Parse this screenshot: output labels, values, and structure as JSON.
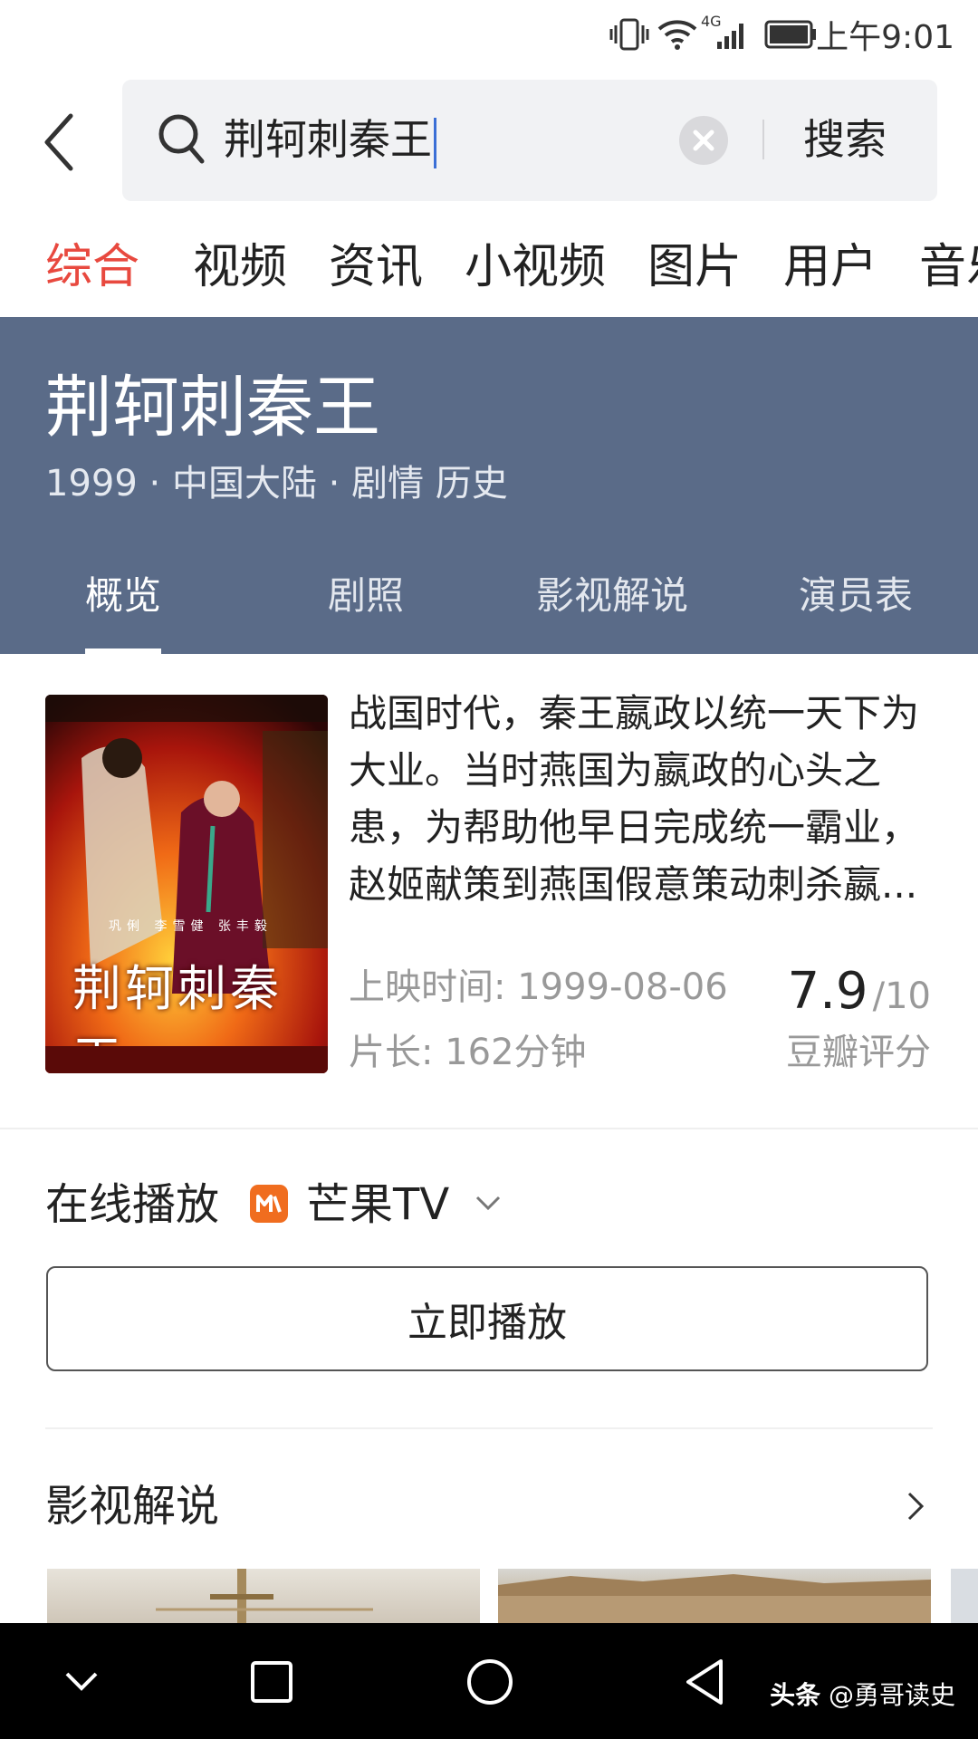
{
  "status_bar": {
    "time": "上午9:01",
    "network": "4G"
  },
  "search": {
    "query": "荆轲刺秦王",
    "submit_label": "搜索"
  },
  "category_tabs": [
    "综合",
    "视频",
    "资讯",
    "小视频",
    "图片",
    "用户",
    "音乐"
  ],
  "movie": {
    "title": "荆轲刺秦王",
    "meta": "1999 · 中国大陆 · 剧情 历史",
    "detail_tabs": [
      "概览",
      "剧照",
      "影视解说",
      "演员表"
    ],
    "synopsis_lines": [
      "战国时代，秦王嬴政以统一天下为",
      "大业。当时燕国为嬴政的心头之",
      "患，为帮助他早日完成统一霸业，",
      "赵姬献策到燕国假意策动刺杀嬴..."
    ],
    "release": "上映时间: 1999-08-06",
    "duration": "片长: 162分钟",
    "score": "7.9",
    "score_max": "/10",
    "score_label": "豆瓣评分",
    "poster_title": "荆轲刺秦王",
    "poster_cast": [
      "巩俐",
      "李雪健",
      "张丰毅"
    ]
  },
  "online": {
    "label": "在线播放",
    "platform": "芒果TV",
    "play_button": "立即播放"
  },
  "commentary": {
    "label": "影视解说"
  },
  "watermark": {
    "brand": "头条",
    "author": "@勇哥读史"
  },
  "colors": {
    "accent": "#e8493f",
    "hero_bg": "#5a6b88",
    "mango": "#f06d1f"
  }
}
